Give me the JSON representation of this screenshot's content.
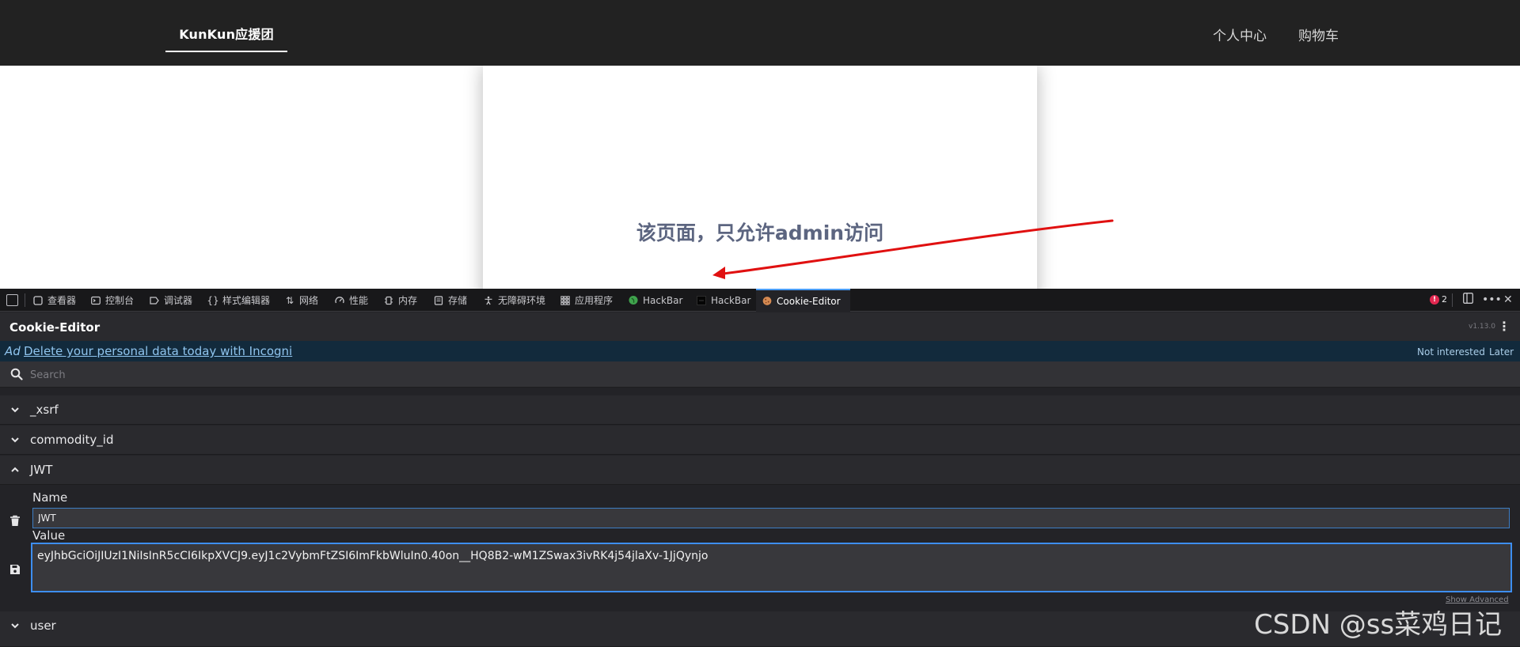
{
  "site": {
    "brand": "KunKun应援团",
    "nav_user": "个人中心",
    "nav_cart": "购物车",
    "message": "该页面，只允许admin访问"
  },
  "devtools": {
    "tabs": [
      {
        "label": "查看器",
        "icon": "inspector-icon"
      },
      {
        "label": "控制台",
        "icon": "console-icon"
      },
      {
        "label": "调试器",
        "icon": "debugger-icon"
      },
      {
        "label": "样式编辑器",
        "icon": "style-editor-icon"
      },
      {
        "label": "网络",
        "icon": "network-icon"
      },
      {
        "label": "性能",
        "icon": "performance-icon"
      },
      {
        "label": "内存",
        "icon": "memory-icon"
      },
      {
        "label": "存储",
        "icon": "storage-icon"
      },
      {
        "label": "无障碍环境",
        "icon": "accessibility-icon"
      },
      {
        "label": "应用程序",
        "icon": "application-icon"
      },
      {
        "label": "HackBar",
        "icon": "hackbar-green-icon"
      },
      {
        "label": "HackBar",
        "icon": "hackbar-dark-icon"
      },
      {
        "label": "Cookie-Editor",
        "icon": "cookie-icon"
      }
    ],
    "error_count": "2"
  },
  "cookie_editor": {
    "title": "Cookie-Editor",
    "version": "v1.13.0",
    "ad": {
      "tag": "Ad",
      "link": "Delete your personal data today with Incogni",
      "not_interested": "Not interested",
      "later": "Later"
    },
    "search_placeholder": "Search",
    "cookies": [
      "_xsrf",
      "commodity_id",
      "JWT",
      "user"
    ],
    "expanded": {
      "name_label": "Name",
      "name_value": "JWT",
      "value_label": "Value",
      "value": "eyJhbGciOiJIUzI1NiIsInR5cCI6IkpXVCJ9.eyJ1c2VybmFtZSI6ImFkbWluIn0.40on__HQ8B2-wM1ZSwax3ivRK4j54jlaXv-1JjQynjo",
      "show_advanced": "Show Advanced"
    }
  },
  "watermark": "CSDN @ss菜鸡日记",
  "colors": {
    "accent": "#3d8ef0",
    "error": "#e22850",
    "annotation_arrow": "#e01010",
    "nav_bg": "#222222"
  }
}
